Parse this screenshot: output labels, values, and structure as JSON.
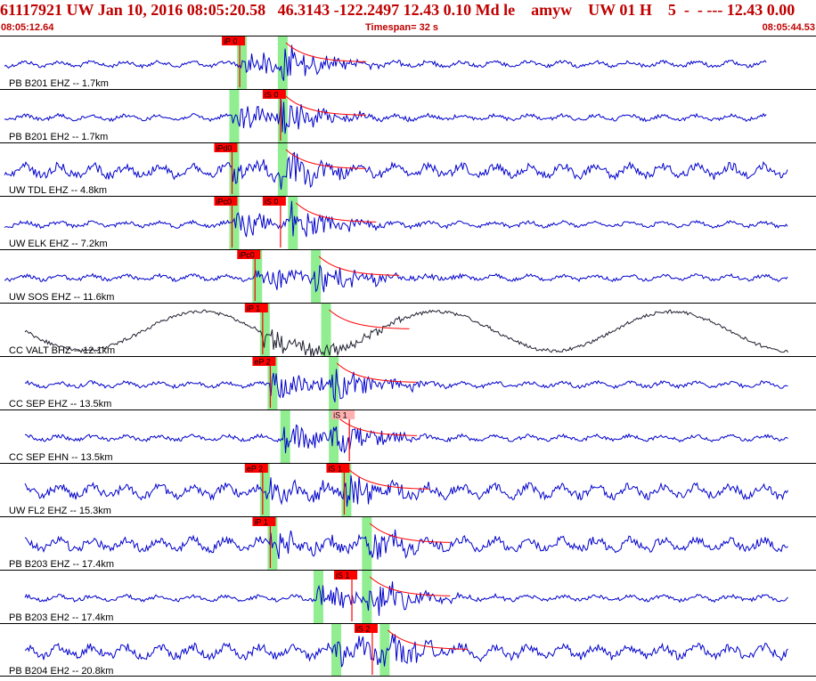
{
  "header": {
    "title": "61117921 UW Jan 10, 2016 08:05:20.58   46.3143 -122.2497 12.43 0.10 Md le    amyw    UW 01 H    5  -  - --- 12.43 0.00",
    "start_time": "08:05:12.64",
    "timespan": "Timespan=  32 s",
    "end_time": "08:05:44.53"
  },
  "colors": {
    "trace": "#0000cc",
    "trace_alt": "#202030",
    "pick": "#ff0000",
    "pick_light": "#ffb0b0",
    "window": "#90ee90",
    "header_text": "#c00000",
    "divider": "#000000"
  },
  "traces": [
    {
      "label": "PB B201 EHZ -- 1.7km",
      "color": "blue",
      "picks": [
        {
          "type": "P",
          "text": "iP 0",
          "t": 9.4,
          "style": "solid"
        }
      ],
      "s_time": 11.0
    },
    {
      "label": "PB B201 EH2 -- 1.7km",
      "color": "blue",
      "picks": [
        {
          "type": "S",
          "text": "iS 0",
          "t": 11.0,
          "style": "solid"
        }
      ],
      "s_time": 11.0
    },
    {
      "label": "UW TDL EHZ -- 4.8km",
      "color": "blue",
      "picks": [
        {
          "type": "P",
          "text": "iPd0",
          "t": 9.1,
          "style": "solid"
        }
      ],
      "s_time": 11.0
    },
    {
      "label": "UW ELK EHZ -- 7.2km",
      "color": "blue",
      "picks": [
        {
          "type": "P",
          "text": "iPc0",
          "t": 9.1,
          "style": "solid"
        },
        {
          "type": "S",
          "text": "iS 0",
          "t": 11.0,
          "style": "solid"
        }
      ],
      "s_time": 11.4
    },
    {
      "label": "UW SOS EHZ -- 11.6km",
      "color": "blue",
      "picks": [
        {
          "type": "P",
          "text": "iPc0",
          "t": 10.0,
          "style": "solid"
        }
      ],
      "s_time": 12.3
    },
    {
      "label": "CC VALT BHZ -- 12.1km",
      "color": "dark",
      "picks": [
        {
          "type": "P",
          "text": "iP 1",
          "t": 10.3,
          "style": "solid"
        }
      ],
      "s_time": 12.7
    },
    {
      "label": "CC SEP EHZ -- 13.5km",
      "color": "blue",
      "picks": [
        {
          "type": "P",
          "text": "eP 2",
          "t": 10.6,
          "style": "solid"
        }
      ],
      "s_time": 13.0
    },
    {
      "label": "CC SEP EHN -- 13.5km",
      "color": "blue",
      "picks": [
        {
          "type": "S",
          "text": "iS 1",
          "t": 13.7,
          "style": "light"
        }
      ],
      "s_time": 13.0
    },
    {
      "label": "UW FL2 EHZ -- 15.3km",
      "color": "blue",
      "picks": [
        {
          "type": "P",
          "text": "eP 2",
          "t": 10.3,
          "style": "solid"
        },
        {
          "type": "S",
          "text": "iS 1",
          "t": 13.5,
          "style": "solid"
        }
      ],
      "s_time": 13.5
    },
    {
      "label": "PB B203 EHZ -- 17.4km",
      "color": "blue",
      "picks": [
        {
          "type": "P",
          "text": "iP 1",
          "t": 10.6,
          "style": "solid"
        }
      ],
      "s_time": 14.3
    },
    {
      "label": "PB B203 EH2 -- 17.4km",
      "color": "blue",
      "picks": [
        {
          "type": "S",
          "text": "iS 1",
          "t": 13.8,
          "style": "solid"
        }
      ],
      "s_time": 14.3
    },
    {
      "label": "PB B204 EH2 -- 20.8km",
      "color": "blue",
      "picks": [
        {
          "type": "S",
          "text": "iS 2",
          "t": 14.6,
          "style": "solid"
        }
      ],
      "s_time": 15.0
    }
  ]
}
